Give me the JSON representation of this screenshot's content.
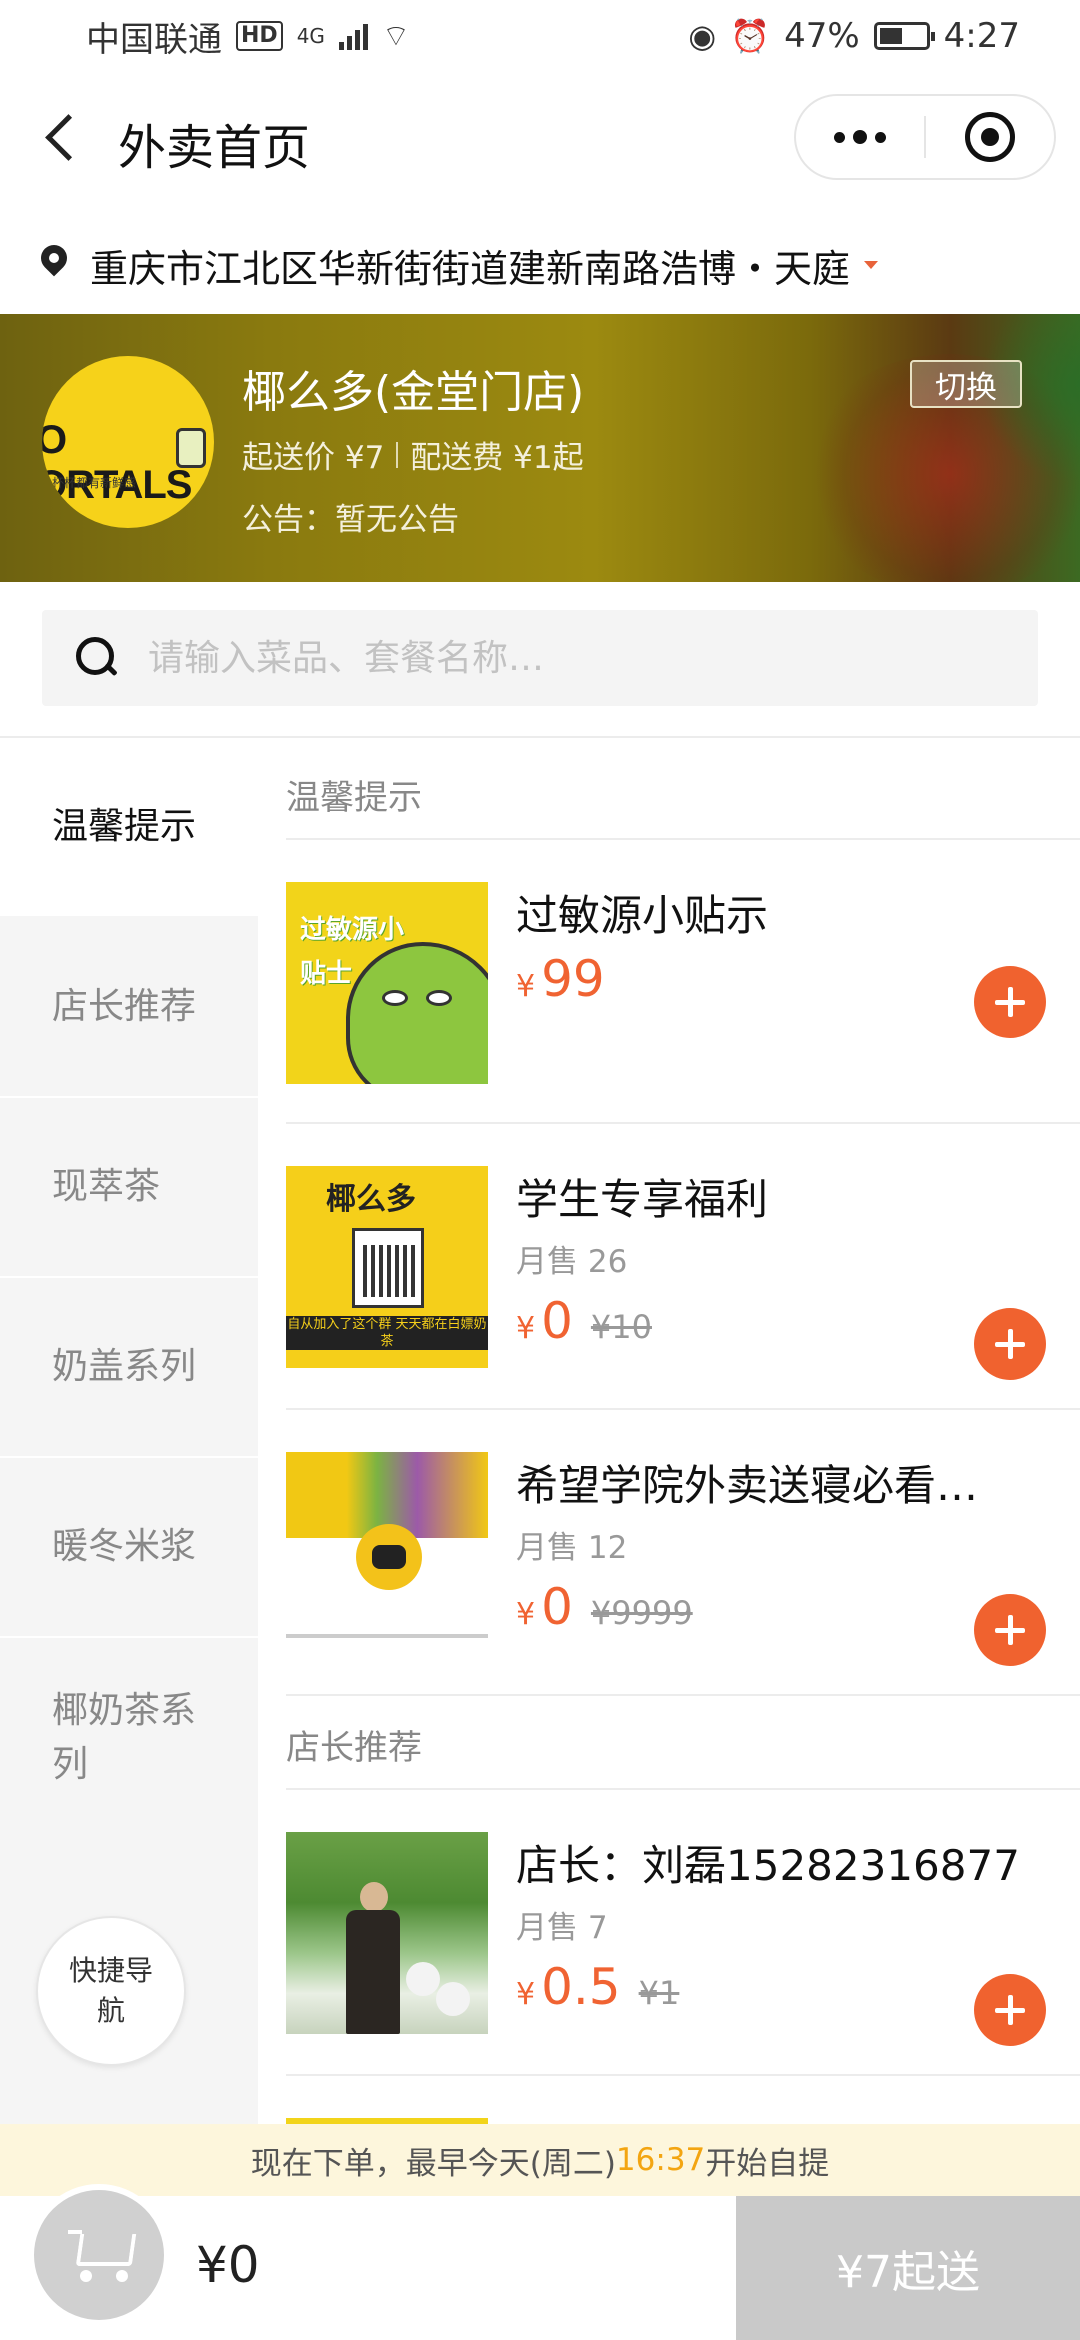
{
  "status_bar": {
    "carrier": "中国联通",
    "hd_badge": "HD",
    "network": "4G",
    "battery_percent": "47%",
    "time": "4:27",
    "battery_level": 0.47
  },
  "nav": {
    "title": "外卖首页",
    "more_icon": "more-dots-icon",
    "close_icon": "target-circle-icon"
  },
  "address": {
    "text": "重庆市江北区华新街街道建新南路浩博・天庭"
  },
  "store": {
    "name": "椰么多(金堂门店)",
    "min_order": "起送价 ¥7",
    "delivery_fee": "配送费 ¥1起",
    "notice": "公告：暂无公告",
    "switch_label": "切换",
    "logo_text": "O\nORTALS",
    "logo_sub": "杯杯都有新鲜感"
  },
  "search": {
    "placeholder": "请输入菜品、套餐名称…"
  },
  "sidebar": {
    "items": [
      {
        "label": "温馨提示",
        "active": true
      },
      {
        "label": "店长推荐",
        "active": false
      },
      {
        "label": "现萃茶",
        "active": false
      },
      {
        "label": "奶盖系列",
        "active": false
      },
      {
        "label": "暖冬米浆",
        "active": false
      },
      {
        "label": "椰奶茶系列",
        "active": false
      }
    ],
    "quick_nav": "快捷导航"
  },
  "sections": [
    {
      "title": "温馨提示",
      "items": [
        {
          "name": "过敏源小贴示",
          "sales": "",
          "yen": "¥",
          "price": "99",
          "original": "",
          "thumb_text": "过敏源小贴士"
        },
        {
          "name": "学生专享福利",
          "sales": "月售 26",
          "yen": "¥",
          "price": "0",
          "original": "¥10",
          "thumb_text": "椰么多",
          "thumb_band": "自从加入了这个群 天天都在白嫖奶茶"
        },
        {
          "name": "希望学院外卖送寝必看…",
          "sales": "月售 12",
          "yen": "¥",
          "price": "0",
          "original": "¥9999"
        }
      ]
    },
    {
      "title": "店长推荐",
      "items": [
        {
          "name": "店长：刘磊15282316877",
          "sales": "月售 7",
          "yen": "¥",
          "price": "0.5",
          "original": "¥1"
        }
      ]
    }
  ],
  "order_tip": {
    "prefix": "现在下单，最早今天(周二)",
    "time": "16:37",
    "suffix": "开始自提"
  },
  "cart": {
    "total": "¥0",
    "checkout_label": "¥7起送"
  },
  "colors": {
    "accent": "#f0622f",
    "tip_time": "#f3a511",
    "tip_bg": "#fdf6dc",
    "checkout_disabled": "#c9c9c9"
  }
}
